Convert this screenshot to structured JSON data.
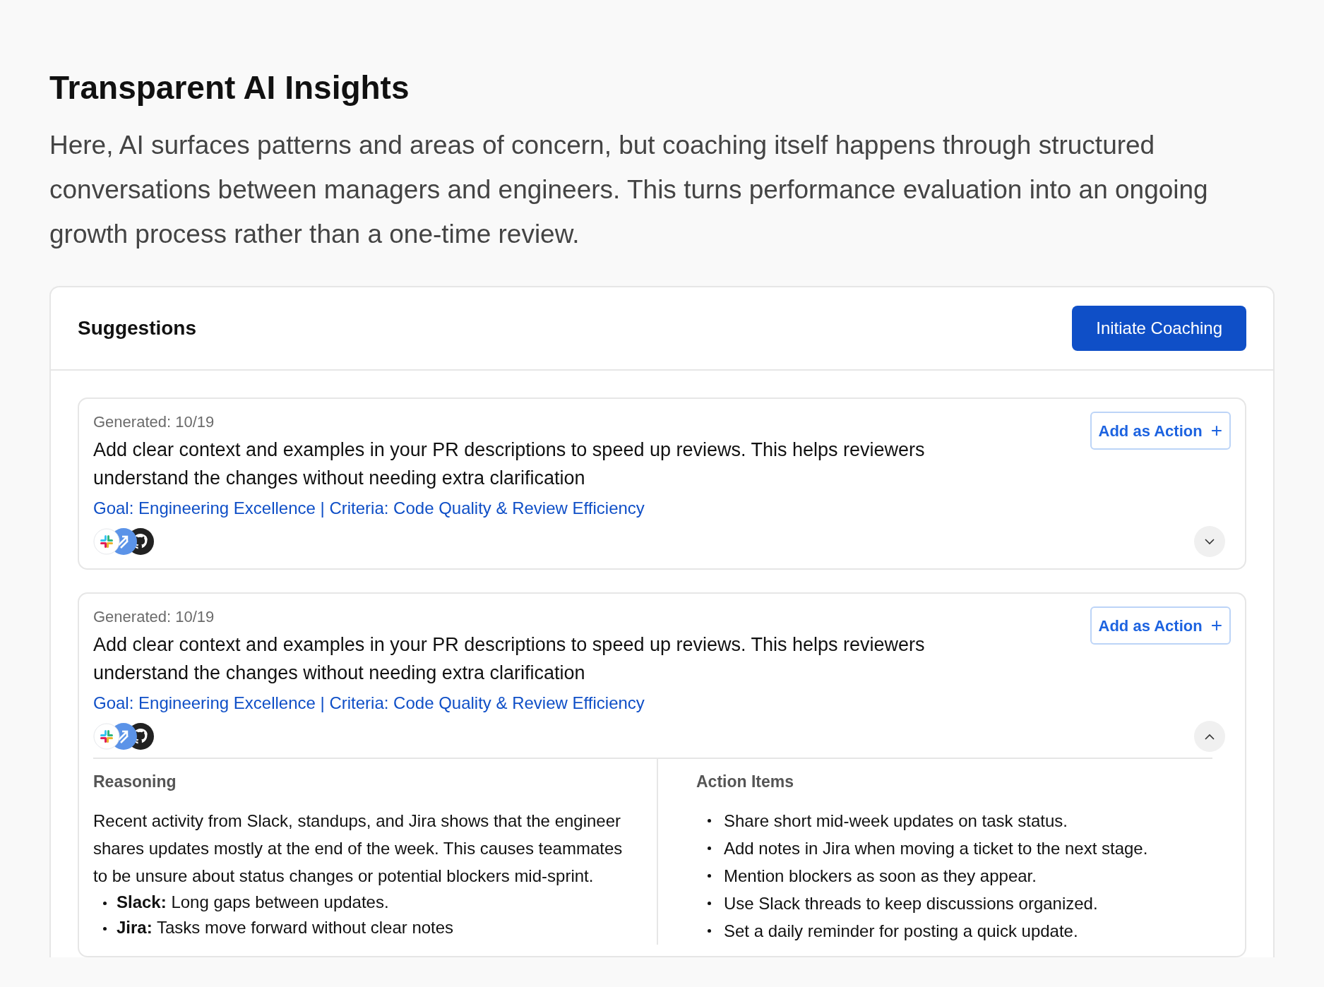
{
  "heading": "Transparent AI Insights",
  "intro": "Here, AI surfaces patterns and areas of concern, but coaching itself happens through structured conversations between managers and engineers. This turns performance evaluation into an ongoing growth process rather than a one-time review.",
  "panel": {
    "title": "Suggestions",
    "primary_button": "Initiate Coaching",
    "suggestions": [
      {
        "generated": "Generated: 10/19",
        "text": "Add clear context and examples in your PR descriptions to speed up reviews. This helps reviewers understand the changes without needing extra clarification",
        "goal": "Goal: Engineering Excellence | Criteria: Code Quality & Review Efficiency",
        "action_button": "Add as Action",
        "add_symbol": "+",
        "expanded": false
      },
      {
        "generated": "Generated: 10/19",
        "text": "Add clear context and examples in your PR descriptions to speed up reviews. This helps reviewers understand the changes without needing extra clarification",
        "goal": "Goal: Engineering Excellence | Criteria: Code Quality & Review Efficiency",
        "action_button": "Add as Action",
        "add_symbol": "+",
        "expanded": true,
        "reasoning": {
          "title": "Reasoning",
          "body": "Recent activity from Slack, standups, and Jira shows that the engineer shares updates mostly at the end of the week. This causes teammates to be unsure about status changes or potential blockers mid-sprint.",
          "bullets": [
            "**Slack:** Long gaps between updates.",
            "**Jira:** Tasks move forward without clear notes"
          ]
        },
        "action_items": {
          "title": "Action Items",
          "bullets": [
            "Share short mid-week updates on task status.",
            "Add notes in Jira when moving a ticket to the next stage.",
            "Mention blockers as soon as they appear.",
            "Use Slack threads to keep discussions organized.",
            "Set a daily reminder for posting a quick update."
          ]
        }
      }
    ]
  }
}
